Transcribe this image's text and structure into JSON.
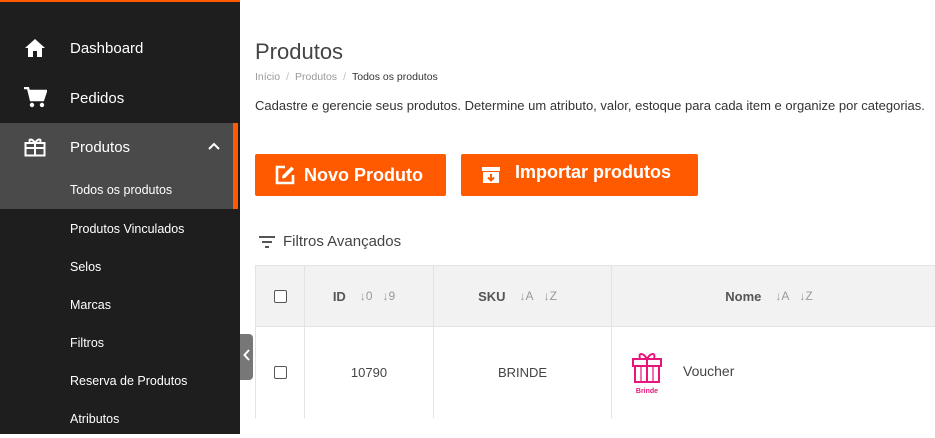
{
  "sidebar": {
    "items": [
      {
        "label": "Dashboard",
        "icon": "home-icon"
      },
      {
        "label": "Pedidos",
        "icon": "cart-icon"
      },
      {
        "label": "Produtos",
        "icon": "gift-box-icon"
      }
    ],
    "subitems": [
      "Todos os produtos",
      "Produtos Vinculados",
      "Selos",
      "Marcas",
      "Filtros",
      "Reserva de Produtos",
      "Atributos"
    ]
  },
  "page": {
    "title": "Produtos",
    "breadcrumb": [
      "Início",
      "Produtos",
      "Todos os produtos"
    ],
    "description": "Cadastre e gerencie seus produtos. Determine um atributo, valor, estoque para cada item e organize por categorias."
  },
  "actions": {
    "novo_label": "Novo Produto",
    "importar_label": "Importar produtos"
  },
  "filters": {
    "label": "Filtros Avançados"
  },
  "table": {
    "columns": [
      {
        "label": "ID",
        "sort_asc": "0",
        "sort_desc": "9"
      },
      {
        "label": "SKU",
        "sort_asc": "A",
        "sort_desc": "Z"
      },
      {
        "label": "Nome",
        "sort_asc": "A",
        "sort_desc": "Z"
      }
    ],
    "rows": [
      {
        "id": "10790",
        "sku": "BRINDE",
        "nome": "Voucher",
        "thumb_text": "Brinde"
      }
    ]
  },
  "colors": {
    "accent": "#ff5a00",
    "sidebar_bg": "#1e1e1e",
    "sidebar_active": "#4a4a4a",
    "thumb": "#e8157a"
  }
}
